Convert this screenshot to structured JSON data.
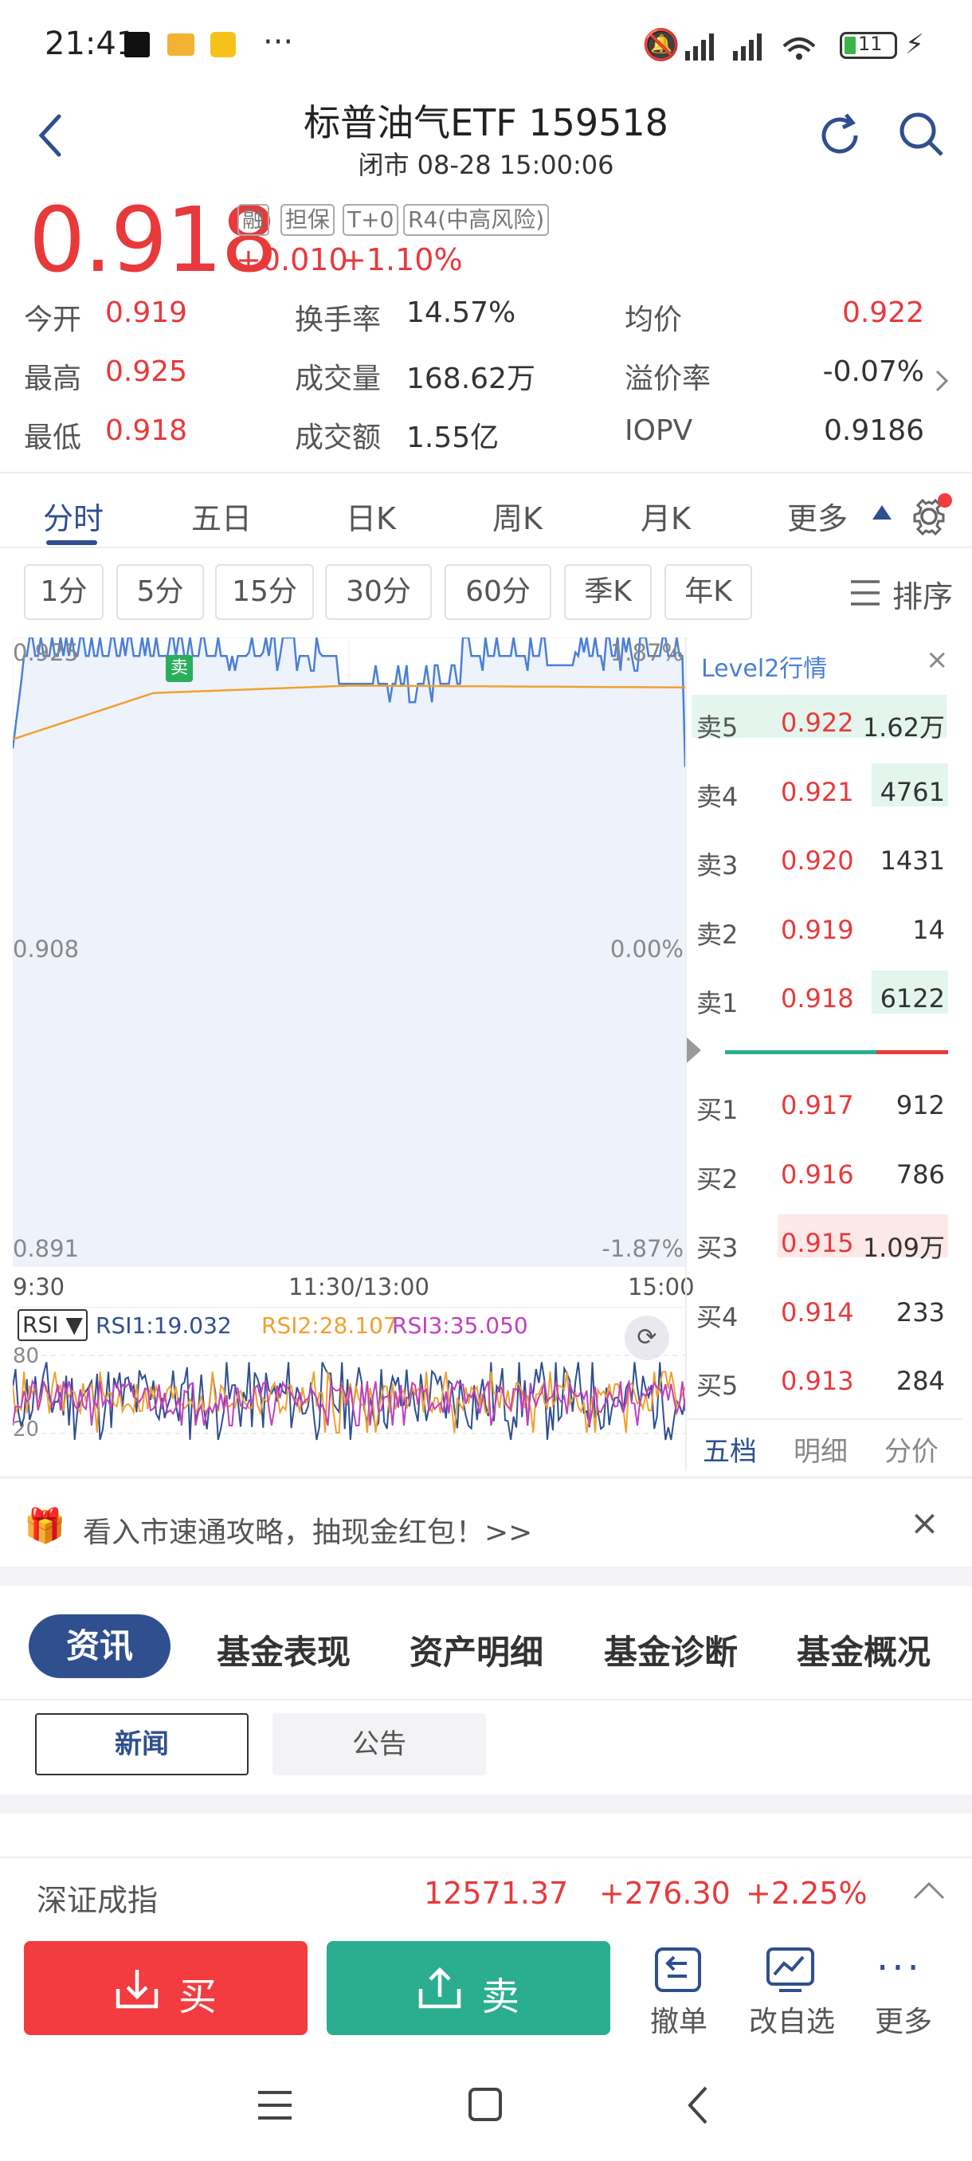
{
  "status_bar": {
    "time": "21:41",
    "battery": "11"
  },
  "header": {
    "title": "标普油气ETF 159518",
    "subtitle": "闭市 08-28 15:00:06"
  },
  "quote": {
    "price": "0.918",
    "tags": [
      "融",
      "担保",
      "T+0",
      "R4(中高风险)"
    ],
    "change": "+0.010",
    "change_pct": "+1.10%"
  },
  "stats": [
    {
      "label": "今开",
      "value": "0.919",
      "label2": "换手率",
      "value2": "14.57%",
      "label3": "均价",
      "value3": "0.922"
    },
    {
      "label": "最高",
      "value": "0.925",
      "label2": "成交量",
      "value2": "168.62万",
      "label3": "溢价率",
      "value3": "-0.07%"
    },
    {
      "label": "最低",
      "value": "0.918",
      "label2": "成交额",
      "value2": "1.55亿",
      "label3": "IOPV",
      "value3": "0.9186"
    }
  ],
  "tabs": [
    "分时",
    "五日",
    "日K",
    "周K",
    "月K",
    "更多"
  ],
  "periods": [
    "1分",
    "5分",
    "15分",
    "30分",
    "60分",
    "季K",
    "年K"
  ],
  "sort_label": "排序",
  "chart_data": {
    "type": "line",
    "ylim": [
      0.891,
      0.925
    ],
    "y_ticks": [
      "0.925",
      "0.908",
      "0.891"
    ],
    "y_right_ticks": [
      "1.87%",
      "0.00%",
      "-1.87%"
    ],
    "x_ticks": [
      "9:30",
      "11:30/13:00",
      "15:00"
    ],
    "marker_label": "卖",
    "series": [
      {
        "name": "price",
        "color": "#4a7fd6"
      },
      {
        "name": "avg",
        "color": "#f0a030"
      }
    ]
  },
  "rsi": {
    "label": "RSI",
    "rsi1": "RSI1:19.032",
    "rsi2": "RSI2:28.107",
    "rsi3": "RSI3:35.050",
    "level_high": "80",
    "level_low": "20",
    "colors": {
      "rsi1": "#2f4f8f",
      "rsi2": "#f0a030",
      "rsi3": "#c040c0"
    }
  },
  "orderbook": {
    "title": "Level2行情",
    "asks": [
      {
        "label": "卖5",
        "price": "0.922",
        "vol": "1.62万"
      },
      {
        "label": "卖4",
        "price": "0.921",
        "vol": "4761"
      },
      {
        "label": "卖3",
        "price": "0.920",
        "vol": "1431"
      },
      {
        "label": "卖2",
        "price": "0.919",
        "vol": "14"
      },
      {
        "label": "卖1",
        "price": "0.918",
        "vol": "6122"
      }
    ],
    "bids": [
      {
        "label": "买1",
        "price": "0.917",
        "vol": "912"
      },
      {
        "label": "买2",
        "price": "0.916",
        "vol": "786"
      },
      {
        "label": "买3",
        "price": "0.915",
        "vol": "1.09万"
      },
      {
        "label": "买4",
        "price": "0.914",
        "vol": "233"
      },
      {
        "label": "买5",
        "price": "0.913",
        "vol": "284"
      }
    ],
    "tabs": [
      "五档",
      "明细",
      "分价"
    ]
  },
  "banner": {
    "text": "看入市速通攻略，抽现金红包！>>"
  },
  "info_tabs": [
    "资讯",
    "基金表现",
    "资产明细",
    "基金诊断",
    "基金概况"
  ],
  "news_tabs": [
    "新闻",
    "公告"
  ],
  "index_bar": {
    "name": "深证成指",
    "value": "12571.37",
    "change": "+276.30",
    "pct": "+2.25%"
  },
  "bottom": {
    "buy": "买",
    "sell": "卖",
    "cancel": "撤单",
    "watch": "改自选",
    "more": "更多"
  }
}
